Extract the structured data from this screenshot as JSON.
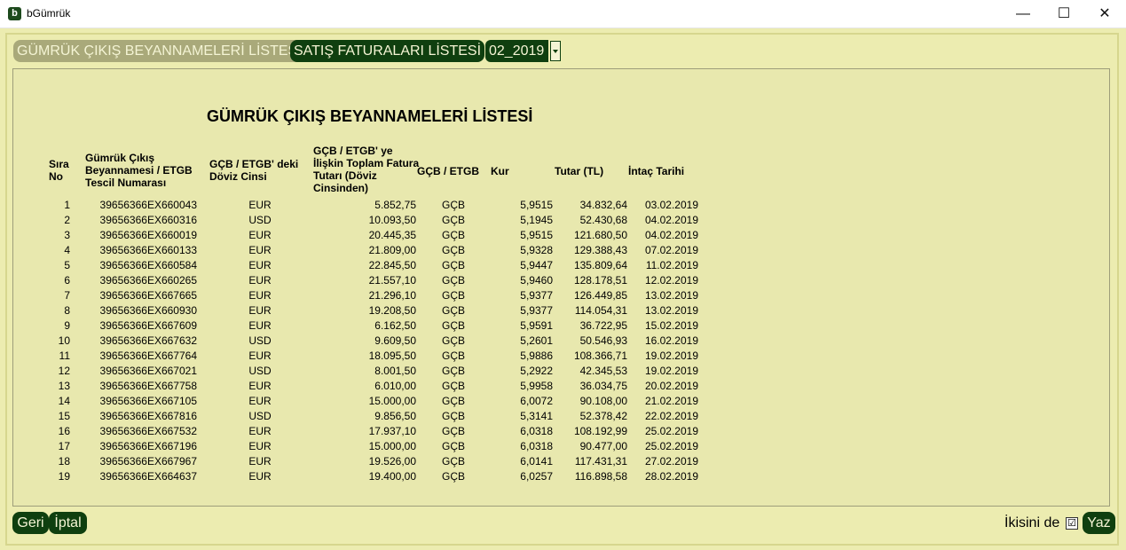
{
  "window": {
    "title": "bGümrük",
    "icon_letter": "b",
    "minimize": "—",
    "maximize": "☐",
    "close": "✕"
  },
  "tabs": {
    "gcb": "GÜMRÜK ÇIKIŞ BEYANNAMELERİ LİSTESİ",
    "sales": "SATIŞ FATURALARI LİSTESİ",
    "period": "02_2019"
  },
  "report": {
    "title": "GÜMRÜK ÇIKIŞ BEYANNAMELERİ LİSTESİ",
    "headers": {
      "sira": "Sıra No",
      "tescil": "Gümrük Çıkış Beyannamesi / ETGB Tescil Numarası",
      "doviz": "GÇB / ETGB' deki Döviz Cinsi",
      "fatura": "GÇB / ETGB' ye İlişkin Toplam Fatura Tutarı (Döviz Cinsinden)",
      "type": "GÇB / ETGB",
      "kur": "Kur",
      "tutar": "Tutar (TL)",
      "tarih": "İntaç Tarihi"
    },
    "rows": [
      {
        "no": "1",
        "tescil": "39656366EX660043",
        "doviz": "EUR",
        "fatura": "5.852,75",
        "type": "GÇB",
        "kur": "5,9515",
        "tutar": "34.832,64",
        "tarih": "03.02.2019"
      },
      {
        "no": "2",
        "tescil": "39656366EX660316",
        "doviz": "USD",
        "fatura": "10.093,50",
        "type": "GÇB",
        "kur": "5,1945",
        "tutar": "52.430,68",
        "tarih": "04.02.2019"
      },
      {
        "no": "3",
        "tescil": "39656366EX660019",
        "doviz": "EUR",
        "fatura": "20.445,35",
        "type": "GÇB",
        "kur": "5,9515",
        "tutar": "121.680,50",
        "tarih": "04.02.2019"
      },
      {
        "no": "4",
        "tescil": "39656366EX660133",
        "doviz": "EUR",
        "fatura": "21.809,00",
        "type": "GÇB",
        "kur": "5,9328",
        "tutar": "129.388,43",
        "tarih": "07.02.2019"
      },
      {
        "no": "5",
        "tescil": "39656366EX660584",
        "doviz": "EUR",
        "fatura": "22.845,50",
        "type": "GÇB",
        "kur": "5,9447",
        "tutar": "135.809,64",
        "tarih": "11.02.2019"
      },
      {
        "no": "6",
        "tescil": "39656366EX660265",
        "doviz": "EUR",
        "fatura": "21.557,10",
        "type": "GÇB",
        "kur": "5,9460",
        "tutar": "128.178,51",
        "tarih": "12.02.2019"
      },
      {
        "no": "7",
        "tescil": "39656366EX667665",
        "doviz": "EUR",
        "fatura": "21.296,10",
        "type": "GÇB",
        "kur": "5,9377",
        "tutar": "126.449,85",
        "tarih": "13.02.2019"
      },
      {
        "no": "8",
        "tescil": "39656366EX660930",
        "doviz": "EUR",
        "fatura": "19.208,50",
        "type": "GÇB",
        "kur": "5,9377",
        "tutar": "114.054,31",
        "tarih": "13.02.2019"
      },
      {
        "no": "9",
        "tescil": "39656366EX667609",
        "doviz": "EUR",
        "fatura": "6.162,50",
        "type": "GÇB",
        "kur": "5,9591",
        "tutar": "36.722,95",
        "tarih": "15.02.2019"
      },
      {
        "no": "10",
        "tescil": "39656366EX667632",
        "doviz": "USD",
        "fatura": "9.609,50",
        "type": "GÇB",
        "kur": "5,2601",
        "tutar": "50.546,93",
        "tarih": "16.02.2019"
      },
      {
        "no": "11",
        "tescil": "39656366EX667764",
        "doviz": "EUR",
        "fatura": "18.095,50",
        "type": "GÇB",
        "kur": "5,9886",
        "tutar": "108.366,71",
        "tarih": "19.02.2019"
      },
      {
        "no": "12",
        "tescil": "39656366EX667021",
        "doviz": "USD",
        "fatura": "8.001,50",
        "type": "GÇB",
        "kur": "5,2922",
        "tutar": "42.345,53",
        "tarih": "19.02.2019"
      },
      {
        "no": "13",
        "tescil": "39656366EX667758",
        "doviz": "EUR",
        "fatura": "6.010,00",
        "type": "GÇB",
        "kur": "5,9958",
        "tutar": "36.034,75",
        "tarih": "20.02.2019"
      },
      {
        "no": "14",
        "tescil": "39656366EX667105",
        "doviz": "EUR",
        "fatura": "15.000,00",
        "type": "GÇB",
        "kur": "6,0072",
        "tutar": "90.108,00",
        "tarih": "21.02.2019"
      },
      {
        "no": "15",
        "tescil": "39656366EX667816",
        "doviz": "USD",
        "fatura": "9.856,50",
        "type": "GÇB",
        "kur": "5,3141",
        "tutar": "52.378,42",
        "tarih": "22.02.2019"
      },
      {
        "no": "16",
        "tescil": "39656366EX667532",
        "doviz": "EUR",
        "fatura": "17.937,10",
        "type": "GÇB",
        "kur": "6,0318",
        "tutar": "108.192,99",
        "tarih": "25.02.2019"
      },
      {
        "no": "17",
        "tescil": "39656366EX667196",
        "doviz": "EUR",
        "fatura": "15.000,00",
        "type": "GÇB",
        "kur": "6,0318",
        "tutar": "90.477,00",
        "tarih": "25.02.2019"
      },
      {
        "no": "18",
        "tescil": "39656366EX667967",
        "doviz": "EUR",
        "fatura": "19.526,00",
        "type": "GÇB",
        "kur": "6,0141",
        "tutar": "117.431,31",
        "tarih": "27.02.2019"
      },
      {
        "no": "19",
        "tescil": "39656366EX664637",
        "doviz": "EUR",
        "fatura": "19.400,00",
        "type": "GÇB",
        "kur": "6,0257",
        "tutar": "116.898,58",
        "tarih": "28.02.2019"
      }
    ]
  },
  "footer": {
    "back": "Geri",
    "cancel": "İptal",
    "both_label": "İkisini de",
    "checkbox_mark": "☑",
    "write": "Yaz"
  }
}
